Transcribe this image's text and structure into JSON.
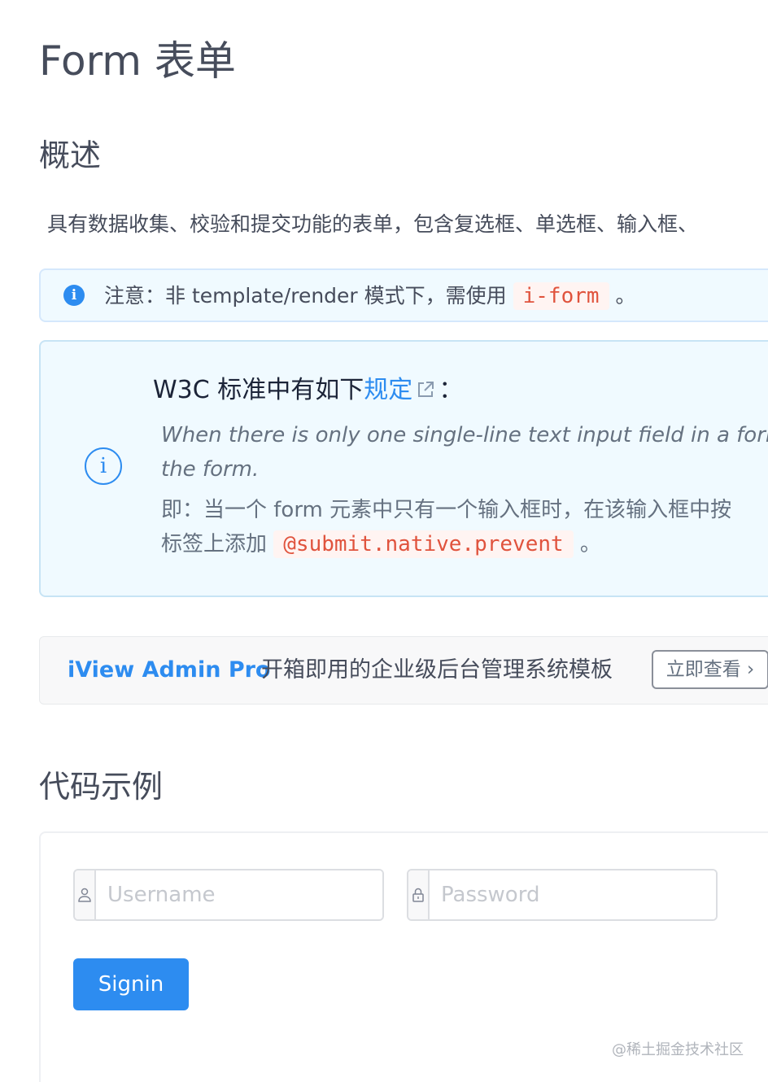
{
  "page": {
    "title": "Form 表单"
  },
  "overview": {
    "heading": "概述",
    "description": "具有数据收集、校验和提交功能的表单，包含复选框、单选框、输入框、"
  },
  "alert": {
    "icon": "info-icon",
    "text_before": "注意：非 template/render 模式下，需使用",
    "code": "i-form",
    "text_after": "。"
  },
  "note": {
    "icon": "info-circle-icon",
    "head_before": "W3C 标准中有如下",
    "head_link": "规定",
    "head_after": "：",
    "quote_line1": "When there is only one single-line text input field in a form,",
    "quote_line2": "the form.",
    "cn_line1": "即：当一个 form 元素中只有一个输入框时，在该输入框中按",
    "cn_line2_before": "标签上添加",
    "cn_code": "@submit.native.prevent",
    "cn_line2_after": "。"
  },
  "promo": {
    "brand": "iView Admin Pro",
    "text": "开箱即用的企业级后台管理系统模板",
    "button_label": "立即查看 ›"
  },
  "examples": {
    "heading": "代码示例",
    "username_placeholder": "Username",
    "password_placeholder": "Password",
    "username_icon": "user-icon",
    "password_icon": "lock-icon",
    "signin_label": "Signin"
  },
  "watermark": "@稀土掘金技术社区",
  "colors": {
    "primary": "#2d8cf0",
    "alert_bg": "#f0faff",
    "code_fg": "#e0533d",
    "code_bg": "#fff4f2"
  }
}
